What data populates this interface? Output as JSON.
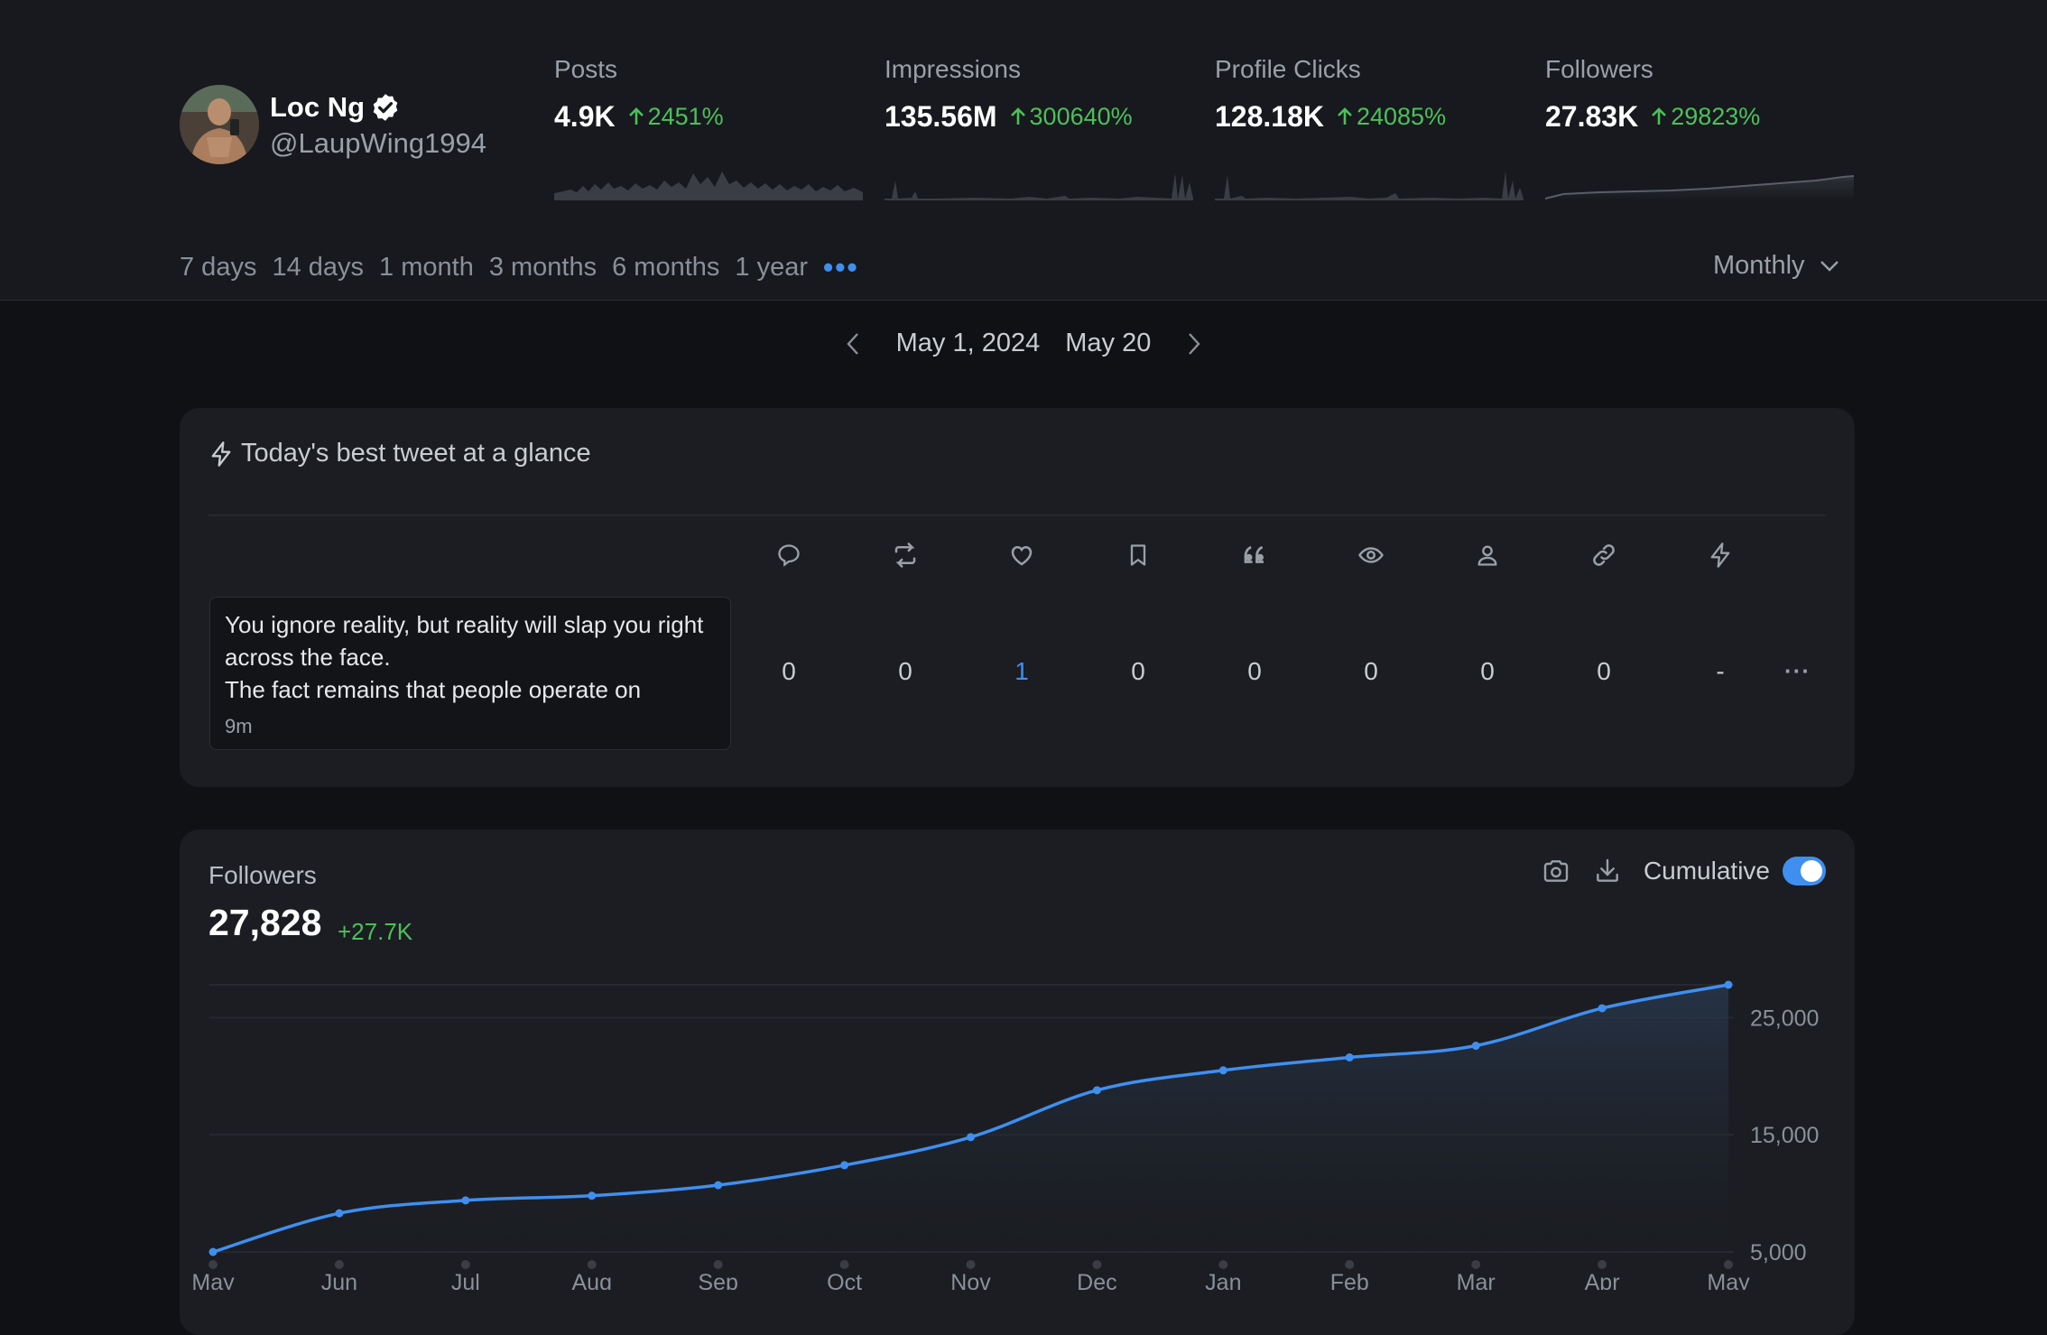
{
  "profile": {
    "name": "Loc Ng",
    "handle": "@LaupWing1994",
    "verified": true
  },
  "stats": [
    {
      "label": "Posts",
      "value": "4.9K",
      "change": "2451%"
    },
    {
      "label": "Impressions",
      "value": "135.56M",
      "change": "300640%"
    },
    {
      "label": "Profile Clicks",
      "value": "128.18K",
      "change": "24085%"
    },
    {
      "label": "Followers",
      "value": "27.83K",
      "change": "29823%"
    }
  ],
  "ranges": [
    "7 days",
    "14 days",
    "1 month",
    "3 months",
    "6 months",
    "1 year"
  ],
  "more_ranges": "•••",
  "granularity": "Monthly",
  "date_nav": {
    "start": "May 1, 2024",
    "end": "May 20"
  },
  "best_tweet": {
    "title": "Today's best tweet at a glance",
    "text": "You ignore reality, but reality will slap you right across the face.\nThe fact remains that people operate on",
    "time": "9m",
    "metrics": [
      {
        "icon": "reply-icon",
        "value": "0"
      },
      {
        "icon": "retweet-icon",
        "value": "0"
      },
      {
        "icon": "heart-icon",
        "value": "1",
        "highlight": true
      },
      {
        "icon": "bookmark-icon",
        "value": "0"
      },
      {
        "icon": "quote-icon",
        "value": "0"
      },
      {
        "icon": "eye-icon",
        "value": "0"
      },
      {
        "icon": "user-icon",
        "value": "0"
      },
      {
        "icon": "link-icon",
        "value": "0"
      },
      {
        "icon": "bolt-icon",
        "value": "-"
      }
    ],
    "more": "···"
  },
  "followers_panel": {
    "title": "Followers",
    "value": "27,828",
    "delta": "+27.7K",
    "cumulative_label": "Cumulative",
    "cumulative_on": true
  },
  "colors": {
    "accent": "#3f8ff0",
    "positive": "#4cc05a",
    "background": "#0f1115",
    "card": "#1b1d22"
  },
  "chart_data": {
    "type": "area",
    "categories": [
      "May",
      "Jun",
      "Jul",
      "Aug",
      "Sep",
      "Oct",
      "Nov",
      "Dec",
      "Jan",
      "Feb",
      "Mar",
      "Apr",
      "May"
    ],
    "values": [
      5000,
      8300,
      9400,
      9800,
      10700,
      12400,
      14800,
      18800,
      20500,
      21600,
      22600,
      25800,
      27800
    ],
    "yticks": [
      5000,
      15000,
      25000
    ],
    "ytick_labels": [
      "5,000",
      "15,000",
      "25,000"
    ],
    "ylim": [
      5000,
      27800
    ],
    "grid": true,
    "xlabel": "",
    "ylabel": ""
  }
}
